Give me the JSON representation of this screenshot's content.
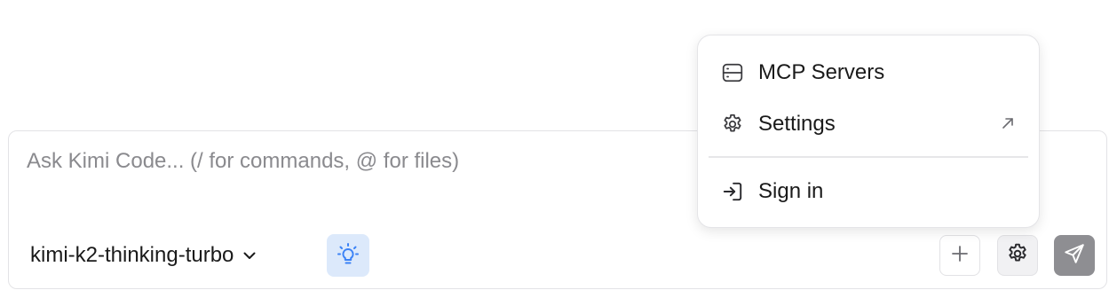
{
  "composer": {
    "placeholder": "Ask Kimi Code... (/ for commands, @ for files)",
    "value": ""
  },
  "toolbar": {
    "model_label": "kimi-k2-thinking-turbo",
    "model_icon": "chevron-down-icon",
    "thinking_icon": "lightbulb-icon",
    "add_icon": "plus-icon",
    "settings_icon": "gear-icon",
    "send_icon": "send-icon"
  },
  "menu": {
    "items": [
      {
        "label": "MCP Servers",
        "icon": "server-icon"
      },
      {
        "label": "Settings",
        "icon": "gear-icon",
        "trailing_icon": "external-arrow-icon"
      },
      {
        "label": "Sign in",
        "icon": "sign-in-icon"
      }
    ]
  },
  "colors": {
    "accent_blue": "#3b82f6",
    "thinking_bg": "#dce9fb",
    "send_bg": "#8e8e92",
    "border": "#e3e3e6"
  }
}
